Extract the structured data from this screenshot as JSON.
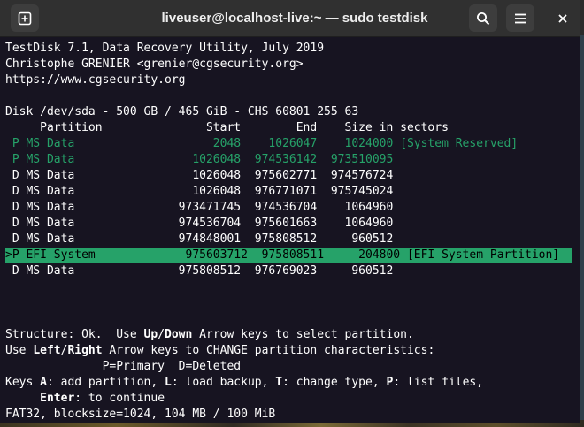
{
  "window": {
    "title": "liveuser@localhost-live:~ — sudo testdisk",
    "icons": {
      "new_tab": "new-tab-icon",
      "search": "search-icon",
      "menu": "hamburger-menu-icon",
      "close": "close-icon"
    }
  },
  "terminal": {
    "header": [
      "TestDisk 7.1, Data Recovery Utility, July 2019",
      "Christophe GRENIER <grenier@cgsecurity.org>",
      "https://www.cgsecurity.org"
    ],
    "disk_line": "Disk /dev/sda - 500 GB / 465 GiB - CHS 60801 255 63",
    "columns_line": "     Partition               Start        End    Size in sectors",
    "partitions": [
      {
        "text": " P MS Data                    2048    1026047    1024000 [System Reserved]"
      },
      {
        "text": " P MS Data                 1026048  974536142  973510095"
      },
      {
        "text": " D MS Data                 1026048  975602771  974576724"
      },
      {
        "text": " D MS Data                 1026048  976771071  975745024"
      },
      {
        "text": " D MS Data               973471745  974536704    1064960"
      },
      {
        "text": " D MS Data               974536704  975601663    1064960"
      },
      {
        "text": " D MS Data               974848001  975808512     960512"
      },
      {
        "text": ">P EFI System             975603712  975808511     204800 [EFI System Partition]"
      },
      {
        "text": " D MS Data               975808512  976769023     960512"
      }
    ],
    "help": {
      "l1_a": "Structure: Ok.  Use ",
      "l1_b": "Up",
      "l1_c": "/",
      "l1_d": "Down",
      "l1_e": " Arrow keys to select partition.",
      "l2_a": "Use ",
      "l2_b": "Left",
      "l2_c": "/",
      "l2_d": "Right",
      "l2_e": " Arrow keys to CHANGE partition characteristics:",
      "l3": "              P=Primary  D=Deleted",
      "l4_a": "Keys ",
      "l4_b": "A",
      "l4_c": ": add partition, ",
      "l4_d": "L",
      "l4_e": ": load backup, ",
      "l4_f": "T",
      "l4_g": ": change type, ",
      "l4_h": "P",
      "l4_i": ": list files,",
      "l5_a": "     ",
      "l5_b": "Enter",
      "l5_c": ": to continue",
      "l6": "FAT32, blocksize=1024, 104 MB / 100 MiB"
    },
    "colors": {
      "background": "#171421",
      "green": "#26a269",
      "text": "#ffffff"
    }
  }
}
